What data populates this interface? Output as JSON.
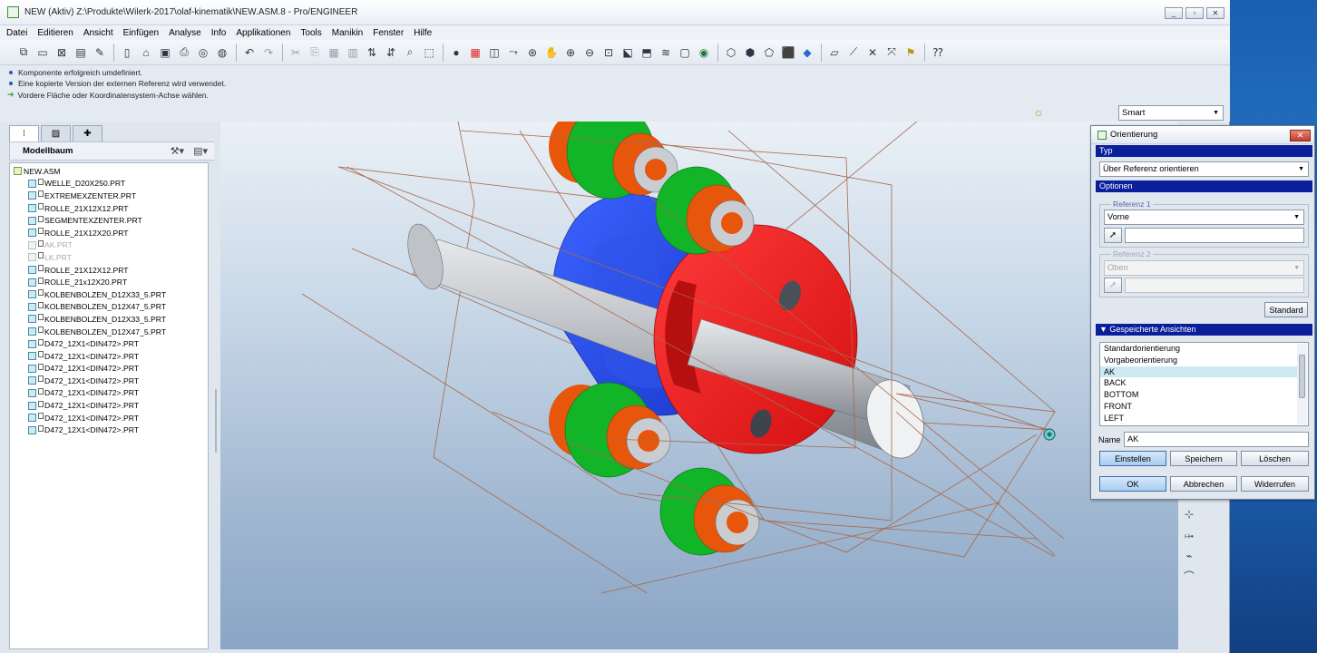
{
  "window": {
    "title": "NEW (Aktiv) Z:\\Produkte\\Wilerk-2017\\olaf-kinematik\\NEW.ASM.8 - Pro/ENGINEER",
    "buttons": [
      "_",
      "▫",
      "✕"
    ]
  },
  "menu": [
    "Datei",
    "Editieren",
    "Ansicht",
    "Einfügen",
    "Analyse",
    "Info",
    "Applikationen",
    "Tools",
    "Manikin",
    "Fenster",
    "Hilfe"
  ],
  "messages": [
    {
      "type": "info",
      "text": "Komponente erfolgreich umdefiniert."
    },
    {
      "type": "info",
      "text": "Eine kopierte Version der externen Referenz wird verwendet."
    },
    {
      "type": "prompt",
      "text": "Vordere Fläche oder Koordinatensystem-Achse wählen."
    }
  ],
  "filter": {
    "value": "Smart"
  },
  "model_tree": {
    "header": "Modellbaum",
    "items": [
      {
        "label": "NEW.ASM",
        "state": "root"
      },
      {
        "label": "WELLE_D20X250.PRT",
        "state": "normal"
      },
      {
        "label": "EXTREMEXZENTER.PRT",
        "state": "normal"
      },
      {
        "label": "ROLLE_21X12X12.PRT",
        "state": "normal"
      },
      {
        "label": "SEGMENTEXZENTER.PRT",
        "state": "normal"
      },
      {
        "label": "ROLLE_21X12X20.PRT",
        "state": "normal"
      },
      {
        "label": "AK.PRT",
        "state": "dim"
      },
      {
        "label": "LK.PRT",
        "state": "dim"
      },
      {
        "label": "ROLLE_21X12X12.PRT",
        "state": "normal"
      },
      {
        "label": "ROLLE_21x12X20.PRT",
        "state": "normal"
      },
      {
        "label": "KOLBENBOLZEN_D12X33_5.PRT",
        "state": "normal"
      },
      {
        "label": "KOLBENBOLZEN_D12X47_5.PRT",
        "state": "normal"
      },
      {
        "label": "KOLBENBOLZEN_D12X33_5.PRT",
        "state": "normal"
      },
      {
        "label": "KOLBENBOLZEN_D12X47_5.PRT",
        "state": "normal"
      },
      {
        "label": "D472_12X1<DIN472>.PRT",
        "state": "normal"
      },
      {
        "label": "D472_12X1<DIN472>.PRT",
        "state": "normal"
      },
      {
        "label": "D472_12X1<DIN472>.PRT",
        "state": "normal"
      },
      {
        "label": "D472_12X1<DIN472>.PRT",
        "state": "normal"
      },
      {
        "label": "D472_12X1<DIN472>.PRT",
        "state": "normal"
      },
      {
        "label": "D472_12X1<DIN472>.PRT",
        "state": "normal"
      },
      {
        "label": "D472_12X1<DIN472>.PRT",
        "state": "normal"
      },
      {
        "label": "D472_12X1<DIN472>.PRT",
        "state": "normal"
      }
    ]
  },
  "dialog": {
    "title": "Orientierung",
    "typ_header": "Typ",
    "typ_value": "Über Referenz orientieren",
    "optionen_header": "Optionen",
    "ref1_label": "Referenz 1",
    "ref1_value": "Vorne",
    "ref2_label": "Referenz 2",
    "ref2_value": "Oben",
    "standard_button": "Standard",
    "saved_views_header": "Gespeicherte Ansichten",
    "saved_views": [
      "Standardorientierung",
      "Vorgabeorientierung",
      "AK",
      "BACK",
      "BOTTOM",
      "FRONT",
      "LEFT"
    ],
    "selected_view": "AK",
    "name_label": "Name",
    "name_value": "AK",
    "einstellen_button": "Einstellen",
    "speichern_button": "Speichern",
    "loeschen_button": "Löschen",
    "ok_button": "OK",
    "abbrechen_button": "Abbrechen",
    "widerrufen_button": "Widerrufen"
  },
  "colors": {
    "shaft": "#b8bcc2",
    "eccentric_red": "#ee1c1c",
    "block_blue": "#2a4ee8",
    "roller_green": "#12b528",
    "pin_orange": "#ee5a0c",
    "frame_lines": "#a8684a",
    "section_header": "#0a1f9a"
  },
  "icons": {
    "toolbar": [
      "new-window-icon",
      "open-icon",
      "close-window-icon",
      "erase-icon",
      "new-file-icon",
      "open-file-icon",
      "save-icon",
      "print-icon",
      "email-icon",
      "undo-icon",
      "redo-icon",
      "cut-icon",
      "copy-icon",
      "paste-icon",
      "regenerate-icon",
      "find-icon",
      "select-box-icon",
      "shading-icon",
      "appearance-icon",
      "model-display-icon",
      "datum-planes-icon",
      "pan-icon",
      "zoom-in-icon",
      "zoom-out-icon",
      "refit-icon",
      "orient-icon",
      "saved-views-icon",
      "layers-icon",
      "view-manager-icon",
      "wireframe-icon",
      "hidden-line-icon",
      "no-hidden-icon",
      "shaded-icon",
      "enhanced-realism-icon",
      "datum-plane-display-icon",
      "axis-display-icon",
      "point-display-icon",
      "csys-display-icon",
      "help-icon"
    ]
  }
}
